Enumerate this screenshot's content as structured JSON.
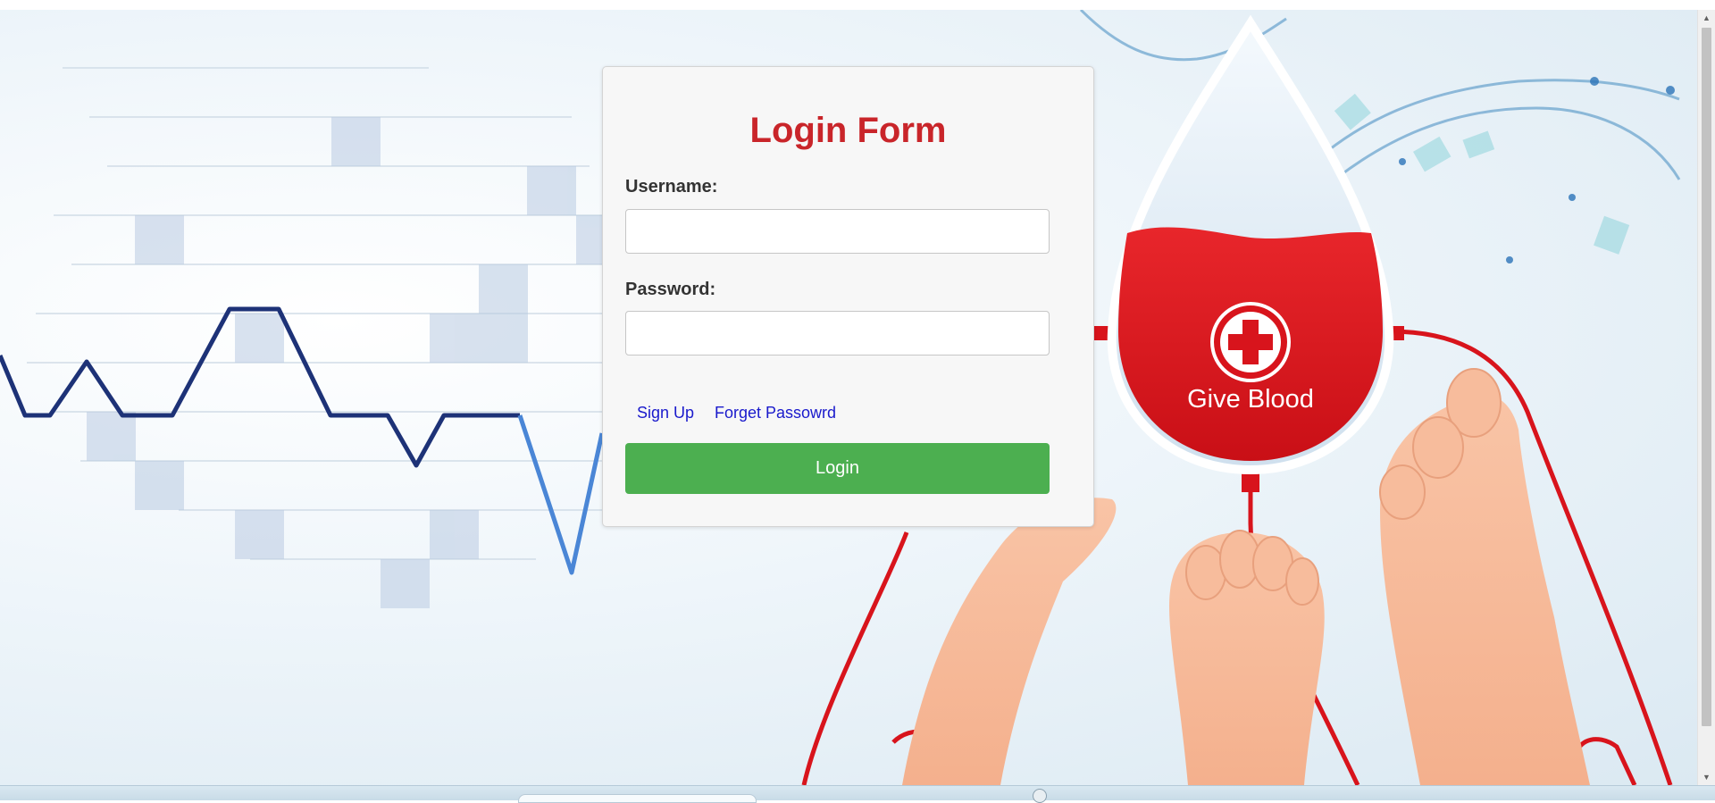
{
  "form": {
    "title": "Login Form",
    "username_label": "Username:",
    "username_value": "",
    "password_label": "Password:",
    "password_value": "",
    "signup_link": "Sign Up",
    "forget_link": "Forget Passowrd",
    "login_button": "Login"
  },
  "banner": {
    "text": "Give Blood",
    "icon": "medical-cross-icon"
  },
  "colors": {
    "title": "#c9252a",
    "login_button": "#4caf50",
    "link": "#1a1acc",
    "blood": "#d8141c",
    "heartbeat_line": "#1d3277"
  }
}
